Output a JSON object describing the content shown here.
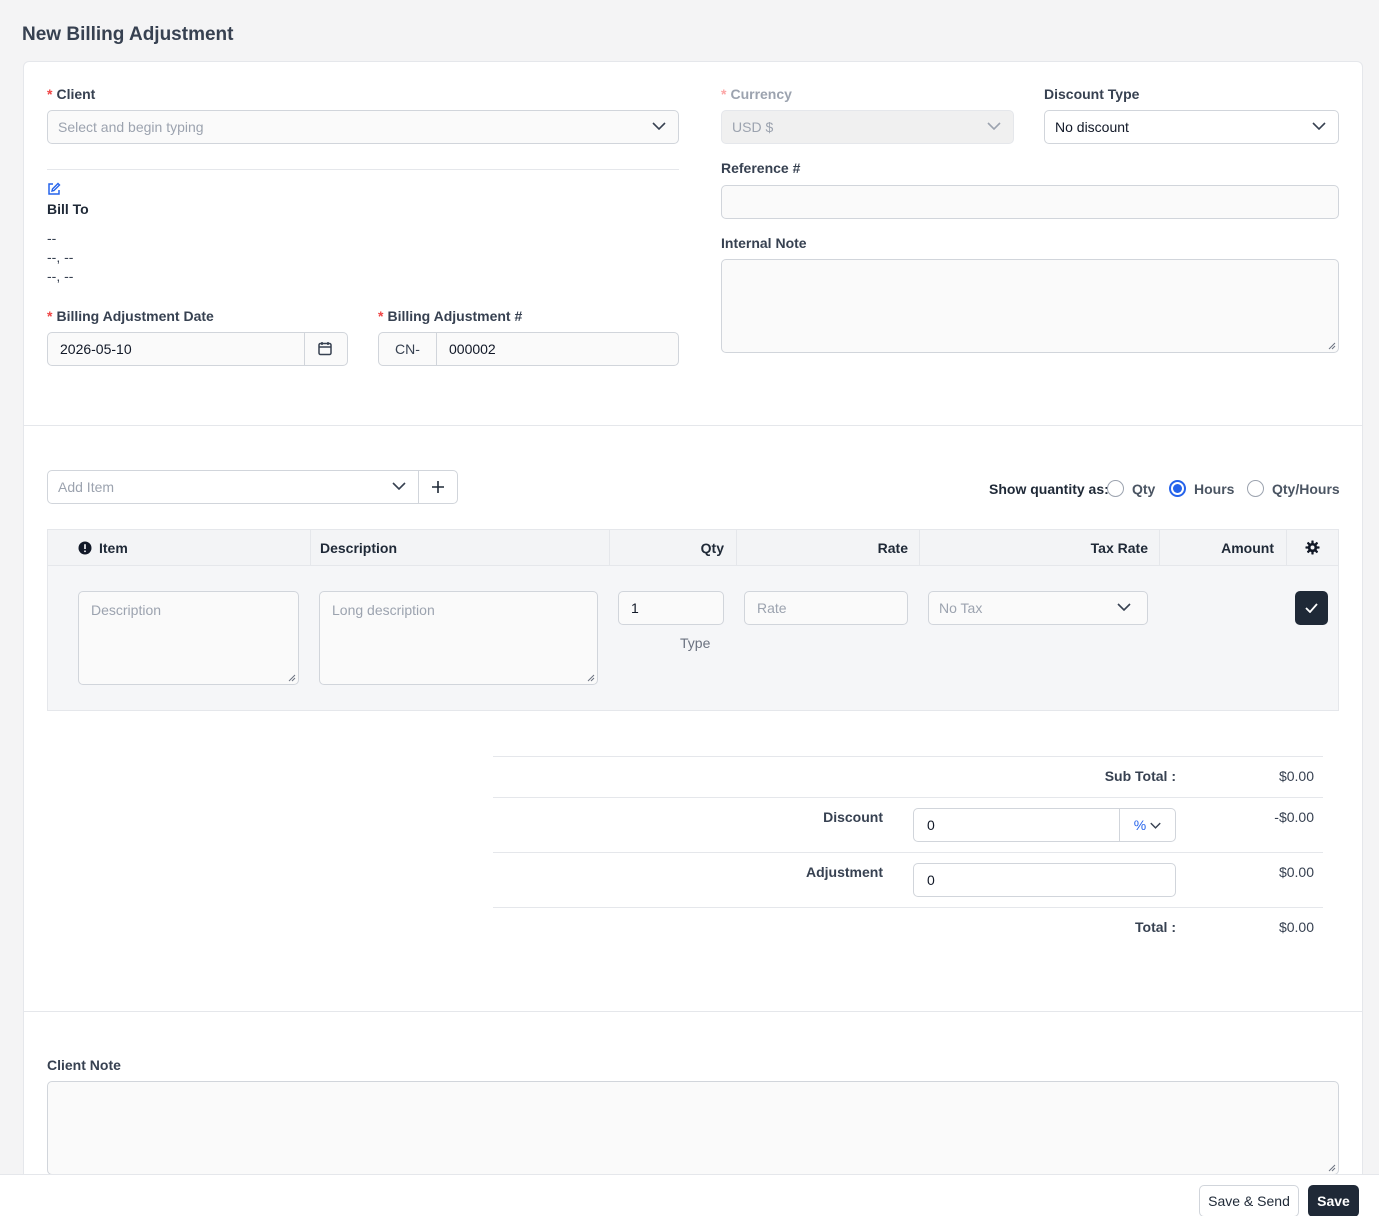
{
  "page": {
    "title": "New Billing Adjustment"
  },
  "client": {
    "label": "Client",
    "placeholder": "Select and begin typing"
  },
  "currency": {
    "label": "Currency",
    "value": "USD $"
  },
  "discount_type": {
    "label": "Discount Type",
    "value": "No discount"
  },
  "reference": {
    "label": "Reference #",
    "value": ""
  },
  "internal_note": {
    "label": "Internal Note"
  },
  "bill_to": {
    "label": "Bill To",
    "line1": "--",
    "line2": "--, --",
    "line3": "--, --"
  },
  "date": {
    "label": "Billing Adjustment Date",
    "value": "2026-05-10"
  },
  "number": {
    "label": "Billing Adjustment #",
    "prefix": "CN-",
    "value": "000002"
  },
  "add_item": {
    "placeholder": "Add Item"
  },
  "show_qty": {
    "label": "Show quantity as:",
    "options": [
      "Qty",
      "Hours",
      "Qty/Hours"
    ],
    "selected": "Hours"
  },
  "table": {
    "headers": {
      "item": "Item",
      "description": "Description",
      "qty": "Qty",
      "rate": "Rate",
      "tax_rate": "Tax Rate",
      "amount": "Amount"
    },
    "row": {
      "item_placeholder": "Description",
      "desc_placeholder": "Long description",
      "qty_value": "1",
      "qty_type": "Type",
      "rate_placeholder": "Rate",
      "tax_value": "No Tax"
    }
  },
  "totals": {
    "subtotal_label": "Sub Total :",
    "subtotal_value": "$0.00",
    "discount_label": "Discount",
    "discount_input": "0",
    "discount_unit": "%",
    "discount_value": "-$0.00",
    "adjustment_label": "Adjustment",
    "adjustment_input": "0",
    "adjustment_value": "$0.00",
    "total_label": "Total :",
    "total_value": "$0.00"
  },
  "client_note": {
    "label": "Client Note"
  },
  "footer": {
    "save_send": "Save & Send",
    "save": "Save"
  },
  "colors": {
    "accent": "#2563eb",
    "dark_button": "#1f2937",
    "required": "#ef4444"
  }
}
